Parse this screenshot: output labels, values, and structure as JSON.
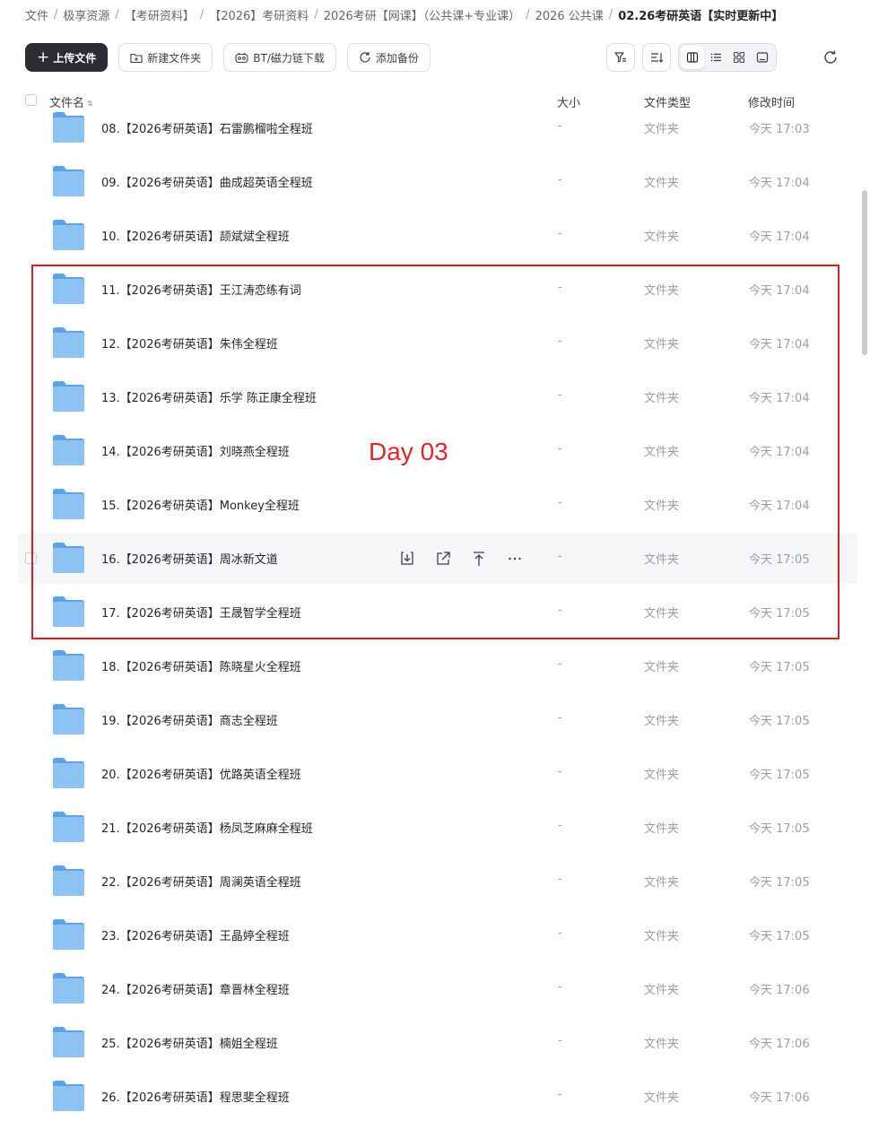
{
  "breadcrumb": [
    {
      "label": "文件"
    },
    {
      "label": "极享资源"
    },
    {
      "label": "【考研资料】"
    },
    {
      "label": "【2026】考研资料"
    },
    {
      "label": "2026考研【网课】（公共课+专业课）"
    },
    {
      "label": "2026 公共课"
    },
    {
      "label": "02.26考研英语【实时更新中】"
    }
  ],
  "toolbar": {
    "upload_label": "上传文件",
    "new_folder_label": "新建文件夹",
    "bt_label": "BT/磁力链下载",
    "backup_label": "添加备份"
  },
  "table": {
    "col_name": "文件名",
    "col_size": "大小",
    "col_type": "文件类型",
    "col_time": "修改时间"
  },
  "files": [
    {
      "name": "08.【2026考研英语】石雷鹏榴啦全程班",
      "size": "-",
      "type": "文件夹",
      "time": "今天 17:03"
    },
    {
      "name": "09.【2026考研英语】曲成超英语全程班",
      "size": "-",
      "type": "文件夹",
      "time": "今天 17:04"
    },
    {
      "name": "10.【2026考研英语】颉斌斌全程班",
      "size": "-",
      "type": "文件夹",
      "time": "今天 17:04"
    },
    {
      "name": "11.【2026考研英语】王江涛恋练有词",
      "size": "-",
      "type": "文件夹",
      "time": "今天 17:04"
    },
    {
      "name": "12.【2026考研英语】朱伟全程班",
      "size": "-",
      "type": "文件夹",
      "time": "今天 17:04"
    },
    {
      "name": "13.【2026考研英语】乐学 陈正康全程班",
      "size": "-",
      "type": "文件夹",
      "time": "今天 17:04"
    },
    {
      "name": "14.【2026考研英语】刘晓燕全程班",
      "size": "-",
      "type": "文件夹",
      "time": "今天 17:04"
    },
    {
      "name": "15.【2026考研英语】Monkey全程班",
      "size": "-",
      "type": "文件夹",
      "time": "今天 17:04"
    },
    {
      "name": "16.【2026考研英语】周冰新文道",
      "size": "-",
      "type": "文件夹",
      "time": "今天 17:05",
      "hover": true
    },
    {
      "name": "17.【2026考研英语】王晟智学全程班",
      "size": "-",
      "type": "文件夹",
      "time": "今天 17:05"
    },
    {
      "name": "18.【2026考研英语】陈晓星火全程班",
      "size": "-",
      "type": "文件夹",
      "time": "今天 17:05"
    },
    {
      "name": "19.【2026考研英语】商志全程班",
      "size": "-",
      "type": "文件夹",
      "time": "今天 17:05"
    },
    {
      "name": "20.【2026考研英语】优路英语全程班",
      "size": "-",
      "type": "文件夹",
      "time": "今天 17:05"
    },
    {
      "name": "21.【2026考研英语】杨凤芝麻麻全程班",
      "size": "-",
      "type": "文件夹",
      "time": "今天 17:05"
    },
    {
      "name": "22.【2026考研英语】周澜英语全程班",
      "size": "-",
      "type": "文件夹",
      "time": "今天 17:05"
    },
    {
      "name": "23.【2026考研英语】王晶婷全程班",
      "size": "-",
      "type": "文件夹",
      "time": "今天 17:05"
    },
    {
      "name": "24.【2026考研英语】章晋林全程班",
      "size": "-",
      "type": "文件夹",
      "time": "今天 17:06"
    },
    {
      "name": "25.【2026考研英语】楠姐全程班",
      "size": "-",
      "type": "文件夹",
      "time": "今天 17:06"
    },
    {
      "name": "26.【2026考研英语】程思斐全程班",
      "size": "-",
      "type": "文件夹",
      "time": "今天 17:06"
    }
  ],
  "row_actions": [
    "download-icon",
    "share-icon",
    "move-top-icon",
    "more-icon"
  ],
  "annotation": {
    "label": "Day 03",
    "color": "#d42027"
  },
  "colors": {
    "folder": "#7db7ee",
    "primary_button": "#2b2d33"
  }
}
